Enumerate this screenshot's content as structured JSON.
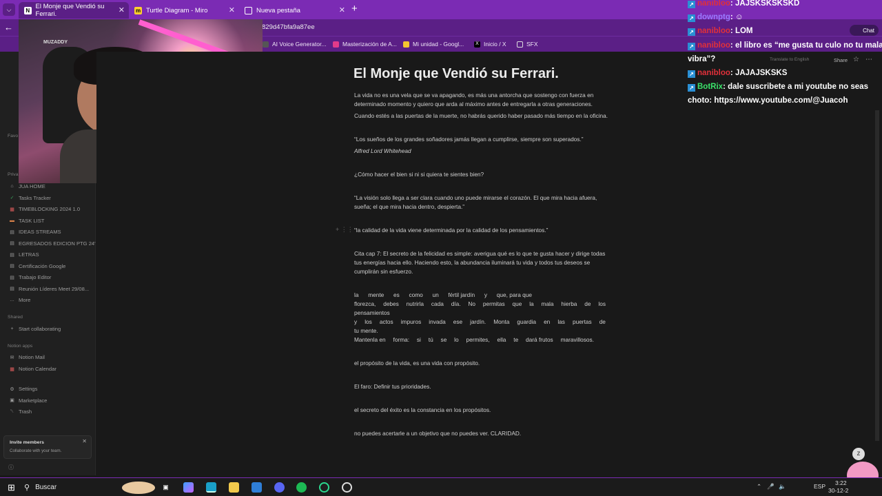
{
  "browser": {
    "tabs": [
      {
        "title": "El Monje que Vendió su Ferrari.",
        "favicon": "notion-icon",
        "active": true
      },
      {
        "title": "Turtle Diagram - Miro",
        "favicon": "miro-icon",
        "active": false
      },
      {
        "title": "Nueva pestaña",
        "favicon": "newtab-icon",
        "active": false
      }
    ],
    "url_fragment": "829d47bfa9a87ee",
    "bookmarks": [
      "AI Voice Generator...",
      "Masterización de A...",
      "Mi unidad - Googl...",
      "Inicio / X",
      "SFX"
    ],
    "toolbar_right": [
      "Share",
      "Translate to English"
    ],
    "accent_color": "#7b2bb4"
  },
  "webcam": {
    "overlay_text": "MUZADDY",
    "description_icon": "webcam-feed"
  },
  "sidebar": {
    "headers": {
      "favorites": "Favo",
      "private": "Priva",
      "shared": "Shared",
      "apps": "Notion apps"
    },
    "private_items": [
      {
        "label": "JUA HOME",
        "icon": "home-icon"
      },
      {
        "label": "Tasks Tracker",
        "icon": "check-icon"
      },
      {
        "label": "TIMEBLOCKING 2024 1.0",
        "icon": "calendar-icon"
      },
      {
        "label": "TASK LIST",
        "icon": "flag-icon"
      },
      {
        "label": "IDEAS STREAMS",
        "icon": "page-icon"
      },
      {
        "label": "EGRESADOS EDICION PTG 24'",
        "icon": "page-icon"
      },
      {
        "label": "LETRAS",
        "icon": "page-icon"
      },
      {
        "label": "Certificación Google",
        "icon": "page-icon"
      },
      {
        "label": "Trabajo Editor",
        "icon": "page-icon"
      },
      {
        "label": "Reunión Líderes Meet 29/08...",
        "icon": "page-icon"
      },
      {
        "label": "More",
        "icon": "more-icon"
      }
    ],
    "shared_items": [
      {
        "label": "Start collaborating",
        "icon": "plus-icon"
      }
    ],
    "app_items": [
      {
        "label": "Notion Mail",
        "icon": "mail-icon"
      },
      {
        "label": "Notion Calendar",
        "icon": "calendar-icon"
      }
    ],
    "bottom_items": [
      {
        "label": "Settings",
        "icon": "gear-icon"
      },
      {
        "label": "Marketplace",
        "icon": "store-icon"
      },
      {
        "label": "Trash",
        "icon": "trash-icon"
      }
    ],
    "invite": {
      "title": "Invite members",
      "subtitle": "Collaborate with your team."
    }
  },
  "document": {
    "title": "El Monje que Vendió su Ferrari.",
    "p1a": "La vida no es una vela que se va apagando, es más una antorcha que sostengo con fuerza en",
    "p1b": "determinado momento y quiero que arda al máximo antes de entregarla a otras generaciones.",
    "p2": "Cuando estés a las puertas de la muerte, no habrás querido haber pasado más tiempo en la oficina.",
    "q1": "“Los sueños de los grandes soñadores jamás llegan a cumplirse, siempre son superados.”",
    "q1_author": "Alfred Lord Whitehead",
    "q2": "¿Cómo hacer el bien si ni si quiera te sientes bien?",
    "q3a": "“La visión solo llega a ser clara cuando uno puede mirarse el corazón. El que mira hacia afuera,",
    "q3b": "sueña; el que mira hacia dentro, despierta.”",
    "q4": "“la calidad de la vida viene determinada por la calidad de los pensamientos.”",
    "cita_a": "Cita cap 7: El secreto de la felicidad es simple: averigua qué es lo que te gusta hacer y dirige todas",
    "cita_b": "tus energías hacia ello. Haciendo esto, la abundancia iluminará tu vida y todos tus deseos se",
    "cita_c": "cumplirán sin esfuerzo.",
    "j1": [
      "la",
      "mente",
      "es",
      "como",
      "un",
      "fértil jardín",
      "y",
      "que, para que"
    ],
    "j2": [
      "florezca,",
      "debes",
      "nutrirla",
      "cada",
      "día.",
      "No",
      "permitas",
      "que",
      "la",
      "mala",
      "hierba",
      "de",
      "los"
    ],
    "j3": "pensamientos",
    "j4": [
      "y",
      "los",
      "actos",
      "impuros",
      "invada",
      "ese",
      "jardín.",
      "Monta",
      "guardia",
      "en",
      "las",
      "puertas",
      "de"
    ],
    "j5": "tu mente.",
    "j6": [
      "Mantenla en",
      "forma:",
      "si",
      "tú",
      "se",
      "lo",
      "permites,",
      "ella",
      "te",
      "dará frutos",
      "maravillosos."
    ],
    "l1": "el propósito de la vida, es una vida con propósito.",
    "l2": "El faro: Definir tus prioridades.",
    "l3": "el secreto del éxito es la constancia en los propósitos.",
    "l4": "no puedes acertarle a un objetivo que no puedes ver. CLARIDAD."
  },
  "chat": [
    {
      "user": "nanibloo",
      "text": ": JAJSKSKSKSKD",
      "color": "#e0303a",
      "badge": "prime-icon"
    },
    {
      "user": "downptg",
      "text": ": ☺",
      "color": "#9a7bff",
      "badge": "prime-icon"
    },
    {
      "user": "nanibloo",
      "text": ": LOM",
      "color": "#e0303a",
      "badge": "prime-icon"
    },
    {
      "user": "nanibloo",
      "text": ": el libro es “me gusta tu culo no tu mala",
      "color": "#e0303a",
      "badge": "prime-icon"
    },
    {
      "user": "",
      "text": "vibra”?",
      "color": "#ffffff",
      "badge": ""
    },
    {
      "user": "nanibloo",
      "text": ": JAJAJSKSKS",
      "color": "#e0303a",
      "badge": "prime-icon"
    },
    {
      "user": "BotRix",
      "text": ": dale suscribete a mi youtube no seas",
      "color": "#3be36b",
      "badge": "prime-icon"
    },
    {
      "user": "",
      "text": "choto: https://www.youtube.com/@Juacoh",
      "color": "#ffffff",
      "badge": ""
    }
  ],
  "taskbar": {
    "search_label": "Buscar",
    "lang": "ESP",
    "time": "3:22",
    "date": "30-12-2"
  }
}
